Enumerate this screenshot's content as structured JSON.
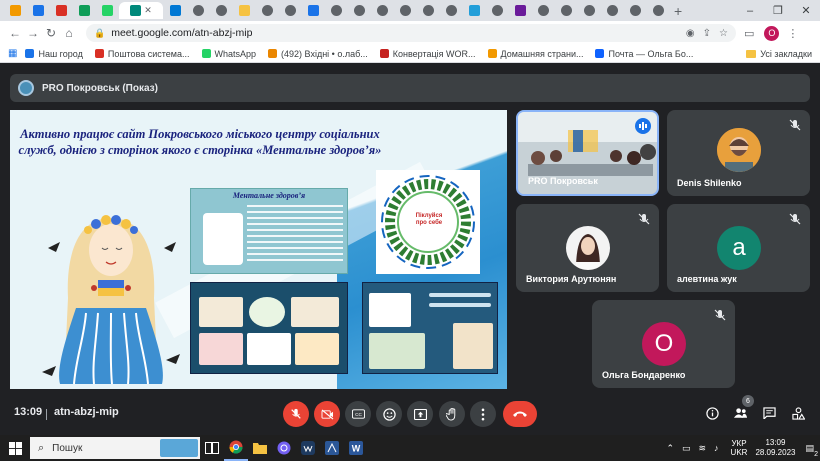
{
  "browser": {
    "tab_count": 28,
    "url": "meet.google.com/atn-abzj-mip",
    "profile_initial": "O",
    "bookmarks": [
      {
        "label": "Наш город",
        "color": "#1a73e8"
      },
      {
        "label": "Поштова система...",
        "color": "#d93025"
      },
      {
        "label": "WhatsApp",
        "color": "#25d366"
      },
      {
        "label": "(492) Вхідні • о.лаб...",
        "color": "#ea8600"
      },
      {
        "label": "Конвертація WOR...",
        "color": "#c5221f"
      },
      {
        "label": "Домашняя страни...",
        "color": "#f29900"
      },
      {
        "label": "Почта — Ольга Бо...",
        "color": "#0f62fe"
      }
    ],
    "other_bookmarks": "Усі закладки"
  },
  "meet": {
    "presenter_title": "PRO Покровськ (Показ)",
    "slide": {
      "heading": "Активно працює сайт Покровського міського центру соціальних служб, однією з сторінок якого є сторінка «Ментальне здоров’я»",
      "poster_title": "Ментальне здоров’я",
      "circle_text": "Піклуйся про себе",
      "circle_words": [
        "mental",
        "health",
        "mental",
        "health",
        "mental",
        "health"
      ]
    },
    "participants": [
      {
        "name": "PRO Покровськ",
        "type": "video",
        "speaking": true
      },
      {
        "name": "Denis Shilenko",
        "type": "photo",
        "muted": true
      },
      {
        "name": "Виктория Арутюнян",
        "type": "photo",
        "muted": true
      },
      {
        "name": "алевтина жук",
        "type": "letter",
        "letter": "a",
        "color": "#12856f",
        "muted": true
      },
      {
        "name": "Ольга Бондаренко",
        "type": "letter",
        "letter": "O",
        "color": "#c2185b",
        "muted": true
      }
    ],
    "controls": {
      "time": "13:09",
      "meeting_code": "atn-abzj-mip",
      "participants_count": "6"
    }
  },
  "taskbar": {
    "search_placeholder": "Пошук",
    "language": "УКР",
    "language_sub": "UKR",
    "time": "13:09",
    "date": "28.09.2023",
    "notifications": "2"
  },
  "colors": {
    "meet_bg": "#202124",
    "tile_bg": "#3c4043",
    "hangup": "#ea4335",
    "speaking": "#8ab4f8"
  }
}
